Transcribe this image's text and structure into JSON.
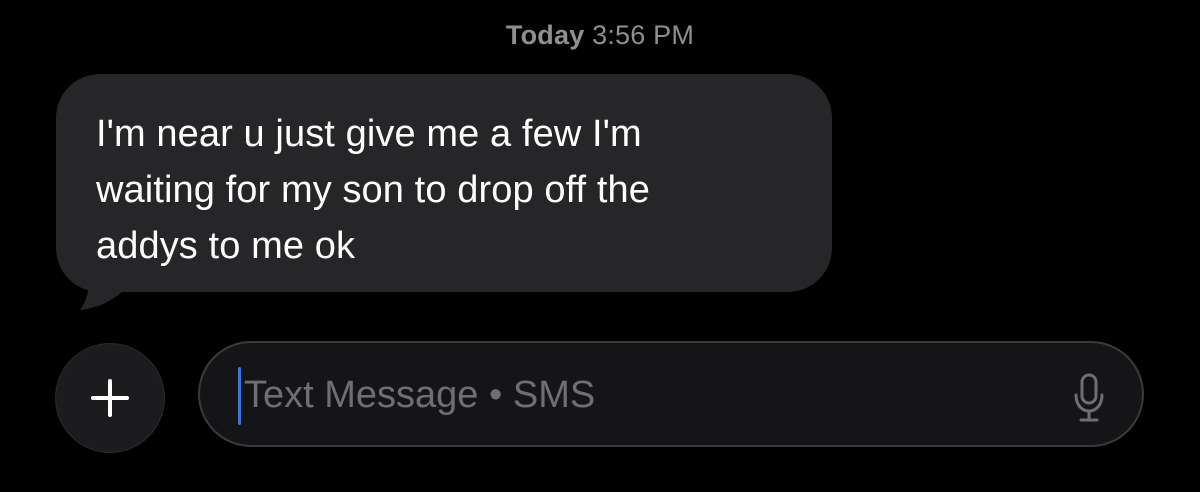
{
  "conversation": {
    "timestamp_day": "Today",
    "timestamp_time": "3:56 PM",
    "messages": [
      {
        "direction": "incoming",
        "lines": [
          "I'm near u just give me a few I'm",
          "waiting for my son to drop off the",
          "addys to me ok"
        ]
      }
    ]
  },
  "composer": {
    "placeholder": "Text Message • SMS",
    "plus_icon": "plus-icon",
    "mic_icon": "microphone-icon"
  },
  "colors": {
    "background": "#000000",
    "incoming_bubble": "#262628",
    "caret": "#3b74d9",
    "secondary_text": "#8e8e93"
  }
}
